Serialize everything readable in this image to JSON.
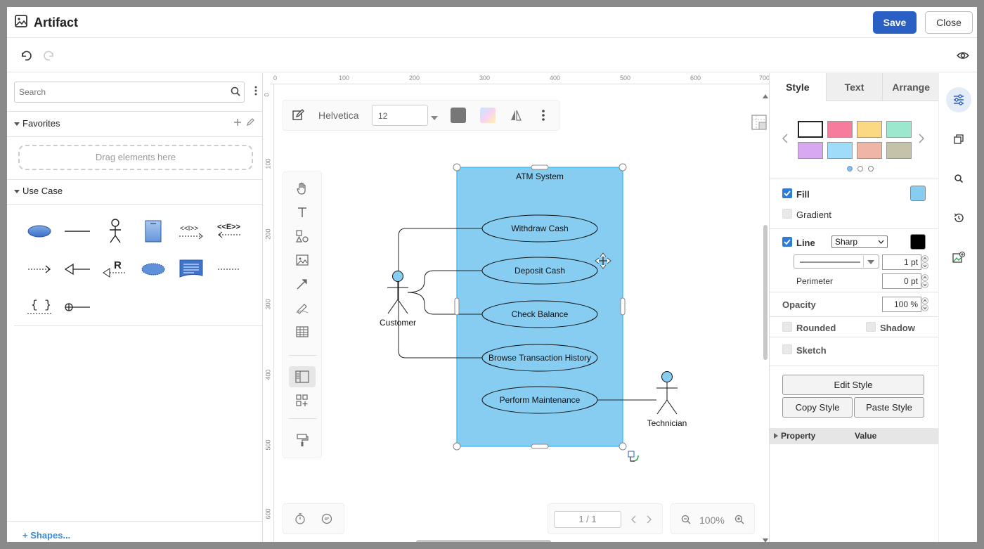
{
  "header": {
    "title": "Artifact",
    "save_label": "Save",
    "close_label": "Close"
  },
  "left_panel": {
    "search_placeholder": "Search",
    "favorites_label": "Favorites",
    "drop_hint": "Drag elements here",
    "use_case_label": "Use Case",
    "more_shapes_label": "Shapes..."
  },
  "format_bar": {
    "font": "Helvetica",
    "font_size": "12"
  },
  "diagram": {
    "system_label": "ATM System",
    "use_cases": [
      "Withdraw Cash",
      "Deposit Cash",
      "Check Balance",
      "Browse Transaction History",
      "Perform Maintenance"
    ],
    "actor1": "Customer",
    "actor2": "Technician",
    "fill_color": "#87cdf1"
  },
  "bottom": {
    "page": "1 / 1",
    "zoom": "100%"
  },
  "ruler": {
    "top_ticks": [
      "0",
      "100",
      "200",
      "300",
      "400",
      "500",
      "600",
      "700"
    ],
    "left_ticks": [
      "0",
      "100",
      "200",
      "300",
      "400",
      "500",
      "600"
    ]
  },
  "right_panel": {
    "tabs": [
      "Style",
      "Text",
      "Arrange"
    ],
    "swatches": [
      "#ffffff",
      "#f77b9a",
      "#fbd982",
      "#9ce8cf",
      "#d8a8f3",
      "#9fdcf9",
      "#efb5a5",
      "#c4c2a8"
    ],
    "fill_label": "Fill",
    "fill_color": "#87cdf1",
    "gradient_label": "Gradient",
    "line_label": "Line",
    "line_style": "Sharp",
    "line_color": "#000000",
    "line_width": "1 pt",
    "perimeter_label": "Perimeter",
    "perimeter_value": "0 pt",
    "opacity_label": "Opacity",
    "opacity_value": "100 %",
    "rounded_label": "Rounded",
    "shadow_label": "Shadow",
    "sketch_label": "Sketch",
    "edit_style": "Edit Style",
    "copy_style": "Copy Style",
    "paste_style": "Paste Style",
    "property_col": "Property",
    "value_col": "Value"
  },
  "colors": {
    "accent": "#2a5fc3",
    "link": "#3a8bd4",
    "checkbox": "#2f7bd9",
    "selection": "#29b6f2"
  }
}
